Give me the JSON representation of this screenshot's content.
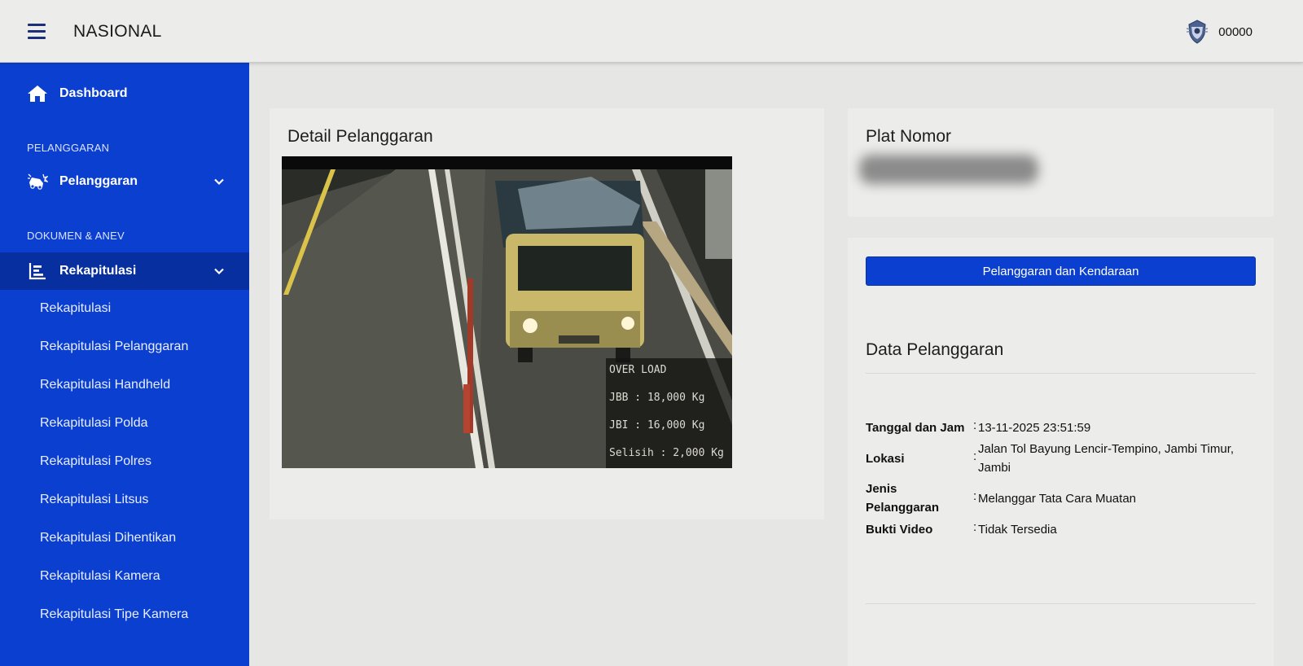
{
  "app": {
    "title": "NASIONAL",
    "user_id": "00000"
  },
  "sidebar": {
    "dashboard": "Dashboard",
    "section_pelanggaran": "PELANGGARAN",
    "pelanggaran": "Pelanggaran",
    "section_dokumen": "DOKUMEN & ANEV",
    "rekapitulasi": "Rekapitulasi",
    "submenu": [
      "Rekapitulasi",
      "Rekapitulasi Pelanggaran",
      "Rekapitulasi Handheld",
      "Rekapitulasi Polda",
      "Rekapitulasi Polres",
      "Rekapitulasi Litsus",
      "Rekapitulasi Dihentikan",
      "Rekapitulasi Kamera",
      "Rekapitulasi Tipe Kamera"
    ]
  },
  "detail": {
    "title": "Detail Pelanggaran",
    "overlay": {
      "status": "OVER LOAD",
      "jbb": "JBB : 18,000 Kg",
      "jbi": "JBI : 16,000 Kg",
      "selisih": "Selisih : 2,000 Kg"
    }
  },
  "plate": {
    "title": "Plat Nomor"
  },
  "data": {
    "button": "Pelanggaran dan Kendaraan",
    "title": "Data Pelanggaran",
    "rows": [
      {
        "label": "Tanggal dan Jam",
        "value": "13-11-2025 23:51:59"
      },
      {
        "label": "Lokasi",
        "value": "Jalan Tol Bayung Lencir-Tempino, Jambi Timur, Jambi"
      },
      {
        "label": "Jenis Pelanggaran",
        "value": "Melanggar Tata Cara Muatan"
      },
      {
        "label": "Bukti Video",
        "value": "Tidak Tersedia"
      }
    ],
    "colon": ":"
  },
  "colors": {
    "sidebar": "#0b3fd0",
    "sidebar_active": "#082fa0",
    "button": "#0b3fd0"
  },
  "icons": [
    "menu-icon",
    "police-emblem-icon",
    "home-icon",
    "car-crash-icon",
    "chevron-down-icon",
    "chart-bars-icon"
  ]
}
